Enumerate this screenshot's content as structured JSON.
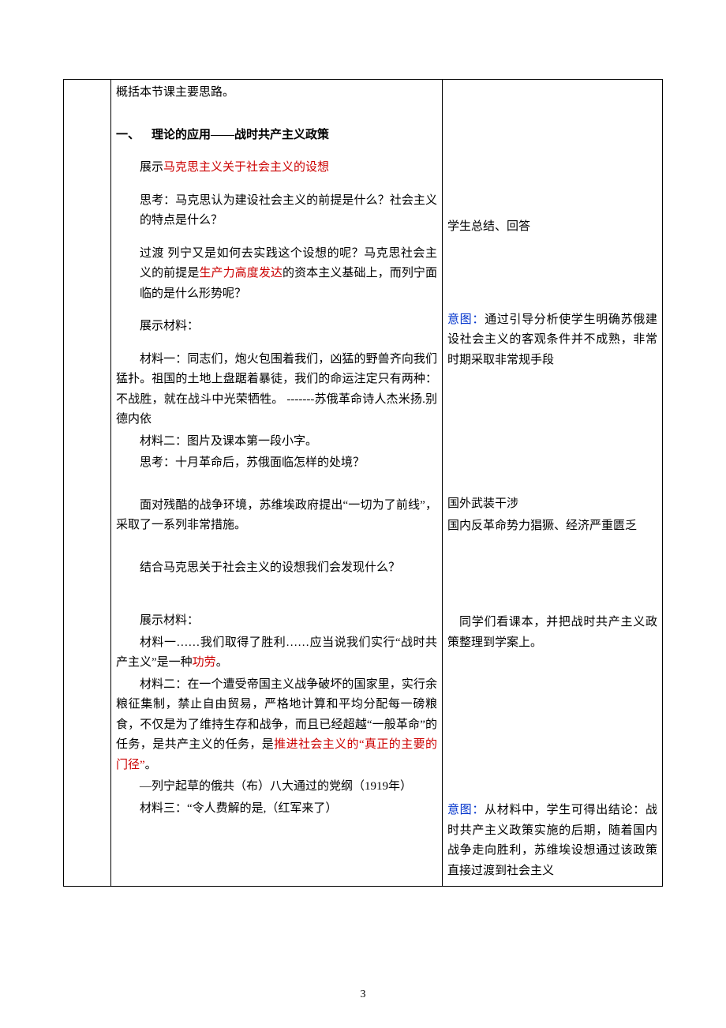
{
  "left": {
    "intro": "概括本节课主要思路。",
    "section1": {
      "number": "一、",
      "title_pre": "理论的应用——战时共产主义政策",
      "line1_pre": "展示",
      "line1_red": "马克思主义关于社会主义的设想",
      "line2": "思考：马克思认为建设社会主义的前提是什么？社会主义的特点是什么？",
      "line3_a": "过渡 列宁又是如何去实践这个设想的呢？马克思社会主义的前提是",
      "line3_red": "生产力高度发达",
      "line3_b": "的资本主义基础上，而列宁面临的是什么形势呢？",
      "line4": "展示材料：",
      "mat1": "材料一：同志们，炮火包围着我们，凶猛的野兽齐向我们猛扑。祖国的土地上盘踞着暴徒，我们的命运注定只有两种：不战胜，就在战斗中光荣牺牲。        -------苏俄革命诗人杰米扬.别德内依",
      "mat2": "材料二：图片及课本第一段小字。",
      "think1": "思考：十月革命后，苏俄面临怎样的处境？",
      "line5": "面对残酷的战争环境，苏维埃政府提出“一切为了前线”，采取了一系列非常措施。",
      "line6": "结合马克思关于社会主义的设想我们会发现什么？",
      "line7": "展示材料：",
      "mat3_a": "材料一……我们取得了胜利……应当说我们实行“战时共产主义”是一种",
      "mat3_red": "功劳",
      "mat3_b": "。",
      "mat4_a": "材料二：在一个遭受帝国主义战争破坏的国家里，实行余粮征集制，禁止自由贸易，严格地计算和平均分配每一磅粮食，不仅是为了维持生存和战争，而且已经超越“一般革命”的任务，是共产主义的任务，是",
      "mat4_red": "推进社会主义的“真正的主要的门径”",
      "mat4_b": "。",
      "mat4_src": "—列宁起草的俄共（布）八大通过的党纲（1919年）",
      "mat5": "材料三：“令人费解的是,（红军来了）"
    }
  },
  "right": {
    "r1": "学生总结、回答",
    "r2_label": "意图：",
    "r2": "通过引导分析使学生明确苏俄建设社会主义的客观条件并不成熟，非常时期采取非常规手段",
    "r3a": "国外武装干涉",
    "r3b": "国内反革命势力猖獗、经济严重匮乏",
    "r4": "同学们看课本，并把战时共产主义政策整理到学案上。",
    "r5_label": "意图：",
    "r5": "从材料中，学生可得出结论：战时共产主义政策实施的后期，随着国内战争走向胜利，苏维埃设想通过该政策直接过渡到社会主义"
  },
  "page_number": "3"
}
